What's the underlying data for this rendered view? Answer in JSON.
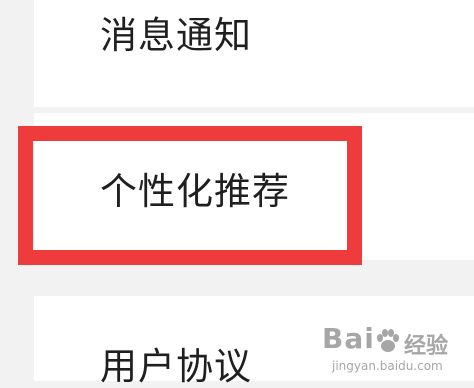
{
  "settings": {
    "items": [
      {
        "label": "消息通知"
      },
      {
        "label": "个性化推荐"
      },
      {
        "label": "用户协议"
      }
    ]
  },
  "annotation": {
    "highlight_color": "#ee3b3b"
  },
  "watermark": {
    "logo": "Bai",
    "brand": "经验",
    "domain": "jingyan.baidu.com"
  }
}
